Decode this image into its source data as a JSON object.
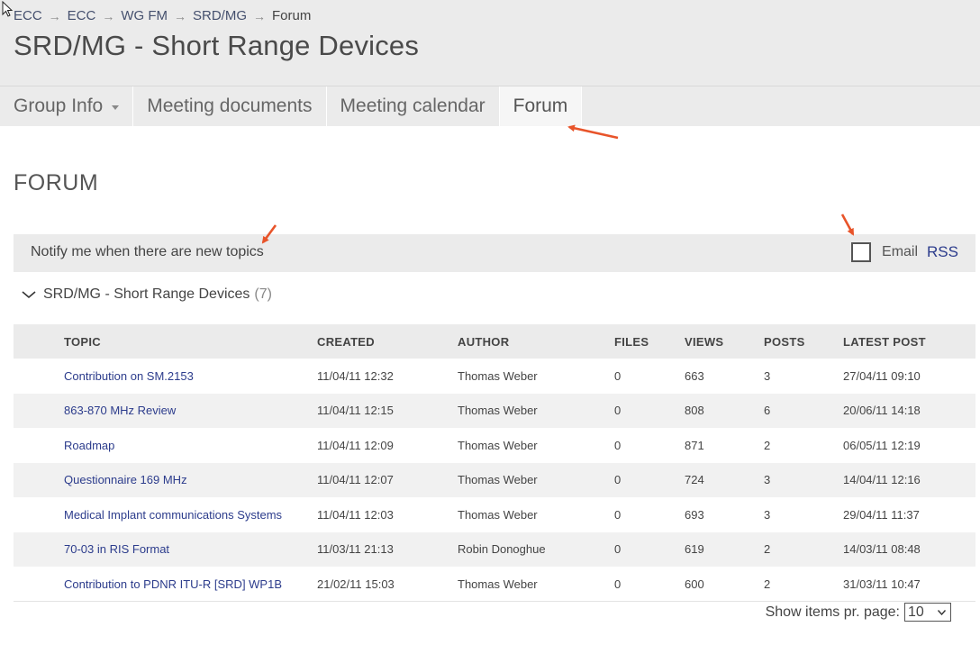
{
  "breadcrumb": {
    "items": [
      "ECC",
      "ECC",
      "WG FM",
      "SRD/MG"
    ],
    "current": "Forum",
    "separator": "→"
  },
  "page_title": "SRD/MG - Short Range Devices",
  "tabs": [
    {
      "label": "Group Info",
      "has_dropdown": true,
      "active": false
    },
    {
      "label": "Meeting documents",
      "active": false
    },
    {
      "label": "Meeting calendar",
      "active": false
    },
    {
      "label": "Forum",
      "active": true
    }
  ],
  "section_title": "FORUM",
  "notify": {
    "text": "Notify me when there are new topics",
    "email_label": "Email",
    "email_checked": false,
    "rss_label": "RSS"
  },
  "group": {
    "name": "SRD/MG - Short Range Devices",
    "count": "(7)",
    "expanded": true
  },
  "table": {
    "headers": [
      "TOPIC",
      "CREATED",
      "AUTHOR",
      "FILES",
      "VIEWS",
      "POSTS",
      "LATEST POST"
    ],
    "rows": [
      [
        "Contribution on SM.2153",
        "11/04/11 12:32",
        "Thomas Weber",
        "0",
        "663",
        "3",
        "27/04/11 09:10"
      ],
      [
        "863-870 MHz Review",
        "11/04/11 12:15",
        "Thomas Weber",
        "0",
        "808",
        "6",
        "20/06/11 14:18"
      ],
      [
        "Roadmap",
        "11/04/11 12:09",
        "Thomas Weber",
        "0",
        "871",
        "2",
        "06/05/11 12:19"
      ],
      [
        "Questionnaire 169 MHz",
        "11/04/11 12:07",
        "Thomas Weber",
        "0",
        "724",
        "3",
        "14/04/11 12:16"
      ],
      [
        "Medical Implant communications Systems",
        "11/04/11 12:03",
        "Thomas Weber",
        "0",
        "693",
        "3",
        "29/04/11 11:37"
      ],
      [
        "70-03 in RIS Format",
        "11/03/11 21:13",
        "Robin Donoghue",
        "0",
        "619",
        "2",
        "14/03/11 08:48"
      ],
      [
        "Contribution to PDNR ITU-R [SRD] WP1B",
        "21/02/11 15:03",
        "Thomas Weber",
        "0",
        "600",
        "2",
        "31/03/11 10:47"
      ]
    ]
  },
  "pager": {
    "label": "Show items pr. page:",
    "value": "10"
  },
  "colors": {
    "link": "#2c3c8c",
    "header_bg": "#ebebeb",
    "annotation_arrow": "#e8542a"
  }
}
